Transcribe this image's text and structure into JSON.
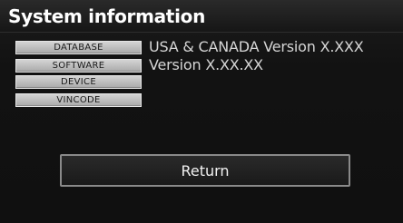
{
  "header": {
    "title": "System information"
  },
  "info_rows": [
    {
      "label": "DATABASE",
      "value": "USA & CANADA Version X.XXX"
    },
    {
      "label": "SOFTWARE",
      "value": "Version X.XX.XX"
    },
    {
      "label": "DEVICE",
      "value": ""
    },
    {
      "label": "VINCODE",
      "value": ""
    }
  ],
  "actions": {
    "return_label": "Return"
  },
  "colors": {
    "background": "#101010",
    "tag_fill": "#c0c0c0",
    "value_text": "#d6d6d6",
    "button_border": "#8a8a8a"
  }
}
